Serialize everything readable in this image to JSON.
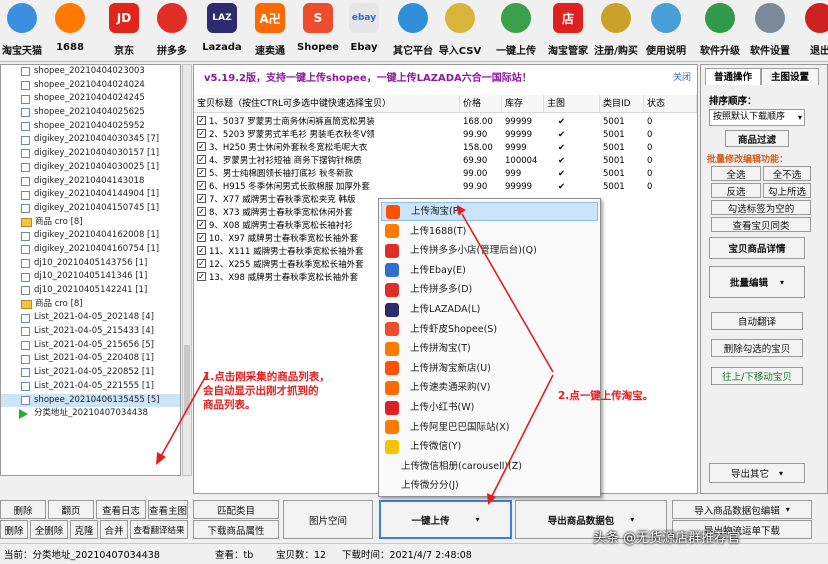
{
  "toolbar": [
    {
      "label": "淘宝天猫",
      "icon": "taobao-icon",
      "color": "#3b8fe0"
    },
    {
      "label": "1688",
      "icon": "1688-icon",
      "color": "#ff7a00"
    },
    {
      "label": "京东",
      "icon": "jd-icon",
      "color": "#e1251b",
      "glyph": "JD"
    },
    {
      "label": "拼多多",
      "icon": "pinduoduo-icon",
      "color": "#e02e24"
    },
    {
      "label": "Lazada",
      "icon": "lazada-icon",
      "color": "#2b2b6e",
      "glyph": "LAZ"
    },
    {
      "label": "速卖通",
      "icon": "aliexpress-icon",
      "color": "#ff6a00",
      "glyph": "A卍"
    },
    {
      "label": "Shopee",
      "icon": "shopee-icon",
      "color": "#ee4d2d",
      "glyph": "S"
    },
    {
      "label": "Ebay",
      "icon": "ebay-icon",
      "color": "#e6e6e6",
      "glyph": "ebay"
    },
    {
      "label": "其它平台",
      "icon": "globe-icon",
      "color": "#2f8fd8"
    },
    {
      "label": "导入CSV",
      "icon": "folder-arrow-icon",
      "color": "#d8b43a"
    },
    {
      "label": "一键上传",
      "icon": "upload-globe-icon",
      "color": "#3aa14a"
    },
    {
      "label": "淘宝管家",
      "icon": "shop-icon",
      "color": "#e02020",
      "glyph": "店"
    },
    {
      "label": "注册/购买",
      "icon": "keys-icon",
      "color": "#c9a227"
    },
    {
      "label": "使用说明",
      "icon": "help-icon",
      "color": "#4a9ed8"
    },
    {
      "label": "软件升级",
      "icon": "update-globe-icon",
      "color": "#2f9a4a"
    },
    {
      "label": "软件设置",
      "icon": "gear-icon",
      "color": "#7a8a9a"
    },
    {
      "label": "退出",
      "icon": "exit-icon",
      "color": "#cc2222"
    }
  ],
  "tree": [
    {
      "text": "shopee_20210404023003",
      "t": "box"
    },
    {
      "text": "shopee_20210404024024",
      "t": "box"
    },
    {
      "text": "shopee_20210404024245",
      "t": "box"
    },
    {
      "text": "shopee_20210404025625",
      "t": "box"
    },
    {
      "text": "shopee_20210404025952",
      "t": "box"
    },
    {
      "text": "digikey_20210404030345 [7]",
      "t": "box"
    },
    {
      "text": "digikey_20210404030157 [1]",
      "t": "box"
    },
    {
      "text": "digikey_20210404030025 [1]",
      "t": "box"
    },
    {
      "text": "digikey_20210404143018",
      "t": "box"
    },
    {
      "text": "digikey_20210404144904 [1]",
      "t": "box"
    },
    {
      "text": "digikey_20210404150745 [1]",
      "t": "box"
    },
    {
      "text": "商品 cro [8]",
      "t": "img"
    },
    {
      "text": "digikey_20210404162008 [1]",
      "t": "box"
    },
    {
      "text": "digikey_20210404160754 [1]",
      "t": "box"
    },
    {
      "text": "dj10_20210405143756 [1]",
      "t": "box"
    },
    {
      "text": "dj10_20210405141346 [1]",
      "t": "box"
    },
    {
      "text": "dj10_20210405142241 [1]",
      "t": "box"
    },
    {
      "text": "商品 cro [8]",
      "t": "img"
    },
    {
      "text": "List_2021-04-05_202148 [4]",
      "t": "box"
    },
    {
      "text": "List_2021-04-05_215433 [4]",
      "t": "box"
    },
    {
      "text": "List_2021-04-05_215656 [5]",
      "t": "box"
    },
    {
      "text": "List_2021-04-05_220408 [1]",
      "t": "box"
    },
    {
      "text": "List_2021-04-05_220852 [1]",
      "t": "box"
    },
    {
      "text": "List_2021-04-05_221555 [1]",
      "t": "box"
    },
    {
      "text": "shopee_20210406135455 [5]",
      "t": "box"
    },
    {
      "text": "分类地址_20210407034438",
      "t": "play"
    }
  ],
  "banner": {
    "text": "v5.19.2版，支持一键上传shopee，一键上传LAZADA六合一国际站！",
    "link": "关闭"
  },
  "table": {
    "headers": [
      "宝贝标题（按住CTRL可多选中键快速选择宝贝）",
      "价格",
      "库存",
      "主图",
      "类目ID",
      "状态"
    ],
    "rows": [
      {
        "title": "1、5037 罗蒙男士商务休闲裤直筒宽松男装",
        "price": "168.00",
        "stock": "99999",
        "img": "✔",
        "cat": "5001",
        "st": "0"
      },
      {
        "title": "2、5203 罗蒙男式羊毛衫 男装毛衣秋冬V领",
        "price": "99.90",
        "stock": "99999",
        "img": "✔",
        "cat": "5001",
        "st": "0"
      },
      {
        "title": "3、H250 男士休闲外套秋冬宽松毛呢大衣",
        "price": "158.00",
        "stock": "9999",
        "img": "✔",
        "cat": "5001",
        "st": "0"
      },
      {
        "title": "4、罗蒙男士衬衫短袖 商务下摆钩针棉质",
        "price": "69.90",
        "stock": "100004",
        "img": "✔",
        "cat": "5001",
        "st": "0"
      },
      {
        "title": "5、男士纯棉圆领长袖打底衫 秋冬新款",
        "price": "99.00",
        "stock": "999",
        "img": "✔",
        "cat": "5001",
        "st": "0"
      },
      {
        "title": "6、H915 冬季休闲男式长款棉服 加厚外套",
        "price": "99.90",
        "stock": "99999",
        "img": "✔",
        "cat": "5001",
        "st": "0"
      },
      {
        "title": "7、X77 威牌男士春秋季宽松夹克 韩版",
        "price": "",
        "stock": "",
        "img": "",
        "cat": "",
        "st": ""
      },
      {
        "title": "8、X73 威牌男士春秋季宽松休闲外套",
        "price": "",
        "stock": "",
        "img": "",
        "cat": "",
        "st": ""
      },
      {
        "title": "9、X08 威牌男士春秋季宽松长袖衬衫",
        "price": "",
        "stock": "",
        "img": "",
        "cat": "",
        "st": ""
      },
      {
        "title": "10、X97 威牌男士春秋季宽松长袖外套",
        "price": "",
        "stock": "",
        "img": "",
        "cat": "",
        "st": ""
      },
      {
        "title": "11、X111 威牌男士春秋季宽松长袖外套",
        "price": "",
        "stock": "",
        "img": "",
        "cat": "",
        "st": ""
      },
      {
        "title": "12、X255 威牌男士春秋季宽松长袖外套",
        "price": "",
        "stock": "",
        "img": "",
        "cat": "",
        "st": ""
      },
      {
        "title": "13、X98 威牌男士春秋季宽松长袖外套",
        "price": "",
        "stock": "",
        "img": "",
        "cat": "",
        "st": ""
      }
    ]
  },
  "menu": [
    {
      "label": "上传淘宝(P)",
      "color": "#ff5000"
    },
    {
      "label": "上传1688(T)",
      "color": "#ff7a00"
    },
    {
      "label": "上传拼多多小店(管理后台)(Q)",
      "color": "#e02e24"
    },
    {
      "label": "上传Ebay(E)",
      "color": "#2f6fcf"
    },
    {
      "label": "上传拼多多(D)",
      "color": "#e02e24"
    },
    {
      "label": "上传LAZADA(L)",
      "color": "#2b2b6e"
    },
    {
      "label": "上传虾皮Shopee(S)",
      "color": "#ee4d2d"
    },
    {
      "label": "上传拼淘宝(T)",
      "color": "#ff7a00"
    },
    {
      "label": "上传拼淘宝新店(U)",
      "color": "#ff5000"
    },
    {
      "label": "上传速卖通采购(V)",
      "color": "#ff6a00"
    },
    {
      "label": "上传小红书(W)",
      "color": "#e02020"
    },
    {
      "label": "上传阿里巴巴国际站(X)",
      "color": "#ff7a00"
    },
    {
      "label": "上传微信(Y)",
      "color": "#f5c400"
    },
    {
      "label": "上传微信相册(carousell)(Z)",
      "color": ""
    },
    {
      "label": "上传微分分(J)",
      "color": ""
    }
  ],
  "right": {
    "tabs": [
      "普通操作",
      "主图设置"
    ],
    "sort_label": "排序顺序：",
    "sort_value": "按照默认下载顺序",
    "btn_filter": "商品过滤",
    "batch_label": "批量修改编辑功能：",
    "grid": [
      "全选",
      "全不选",
      "反选",
      "勾上所选"
    ],
    "check_selected": "勾选标签为空的",
    "view_same": "查看宝贝同类",
    "detail": "宝贝商品详情",
    "batch_edit": "批量编辑",
    "auto_translate": "自动翻译",
    "delete_selected": "删除勾选的宝贝",
    "move_updown": "往上/下移动宝贝",
    "export": "导出其它"
  },
  "bottom": {
    "b1": "删除",
    "b2": "翻页",
    "b3": "查看日志",
    "b4": "查看主图",
    "b5": "删除",
    "b6": "全删除",
    "b7": "克隆",
    "b8": "合并",
    "b9": "查看翻译结果",
    "match": "匹配类目",
    "download_attr": "下载商品属性",
    "image_space": "图片空间",
    "one_click": "一键上传",
    "export_pkg": "导出商品数据包",
    "import_export": "导入商品数据包编辑",
    "send_msg": "导出物流运单下载"
  },
  "status": {
    "tree": "当前：分类地址_20210407034438",
    "view": "查看：tb",
    "count": "宝贝数：12",
    "time": "下载时间：2021/4/7 2:48:08"
  },
  "annotations": {
    "note1_l1": "1.点击刚采集的商品列表，",
    "note1_l2": "会自动显示出刚才抓到的",
    "note1_l3": "商品列表。",
    "note2": "2.点一键上传淘宝。"
  },
  "watermark": "头条 @无货源店群推荐官",
  "colors": {
    "accent": "#e02020",
    "menu_highlight": "#cce4f8",
    "banner": "#8a1a9c"
  }
}
